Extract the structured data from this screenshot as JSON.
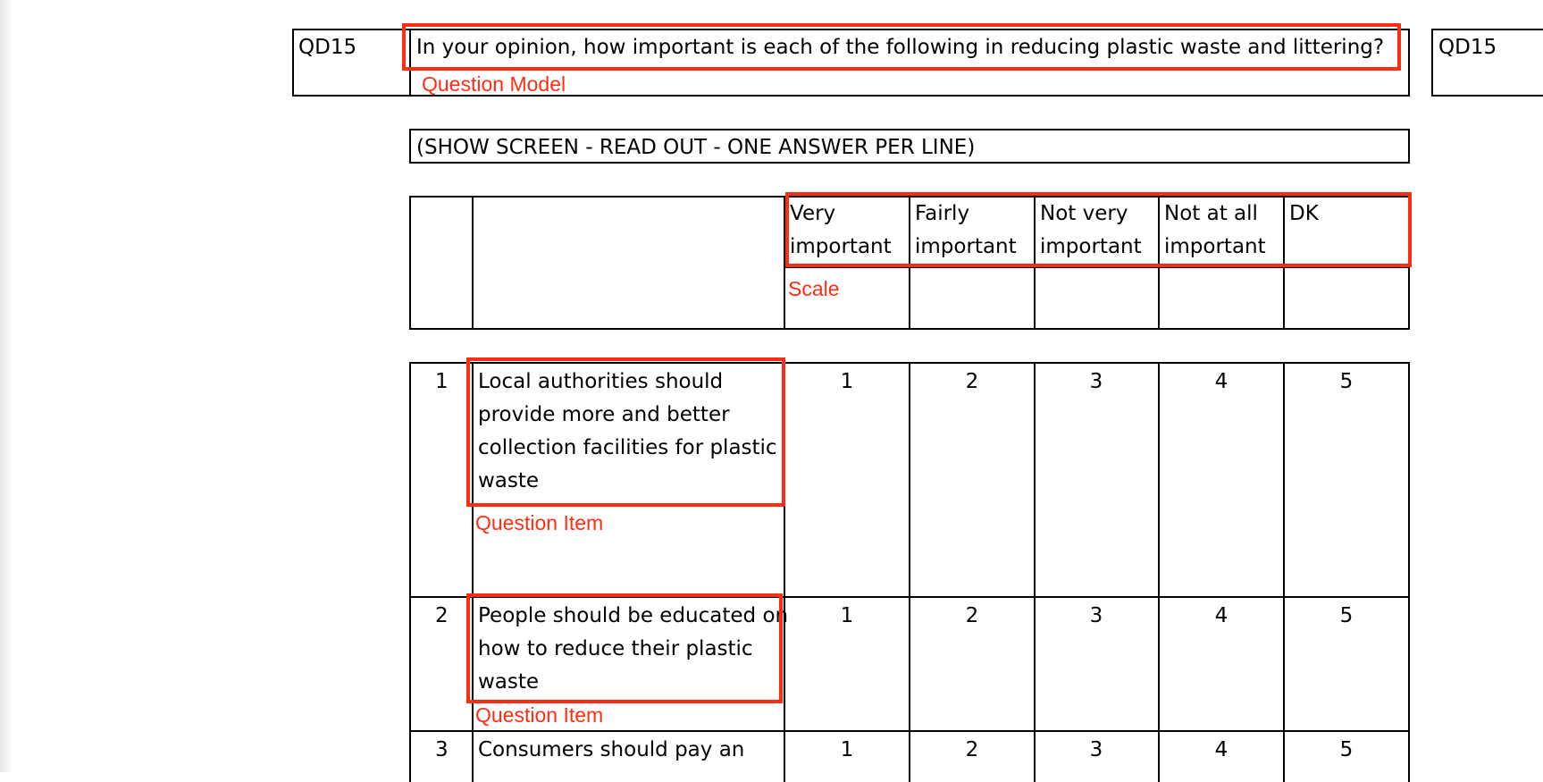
{
  "question": {
    "code": "QD15",
    "text": "In your opinion, how important is each of the following in reducing plastic waste and littering?",
    "instruction": "(SHOW SCREEN - READ OUT - ONE ANSWER PER LINE)",
    "next_code": "QD15"
  },
  "scale": {
    "headers": [
      [
        "Very",
        "important"
      ],
      [
        "Fairly",
        "important"
      ],
      [
        "Not very",
        "important"
      ],
      [
        "Not at all",
        "important"
      ],
      [
        "DK",
        ""
      ]
    ]
  },
  "items": [
    {
      "number": "1",
      "lines": [
        "Local authorities should",
        "provide more and better",
        "collection facilities for plastic",
        "waste"
      ],
      "codes": [
        "1",
        "2",
        "3",
        "4",
        "5"
      ]
    },
    {
      "number": "2",
      "lines": [
        "People should be educated on",
        "how to reduce their plastic",
        "waste"
      ],
      "codes": [
        "1",
        "2",
        "3",
        "4",
        "5"
      ]
    },
    {
      "number": "3",
      "lines": [
        "Consumers should pay an"
      ],
      "codes": [
        "1",
        "2",
        "3",
        "4",
        "5"
      ]
    }
  ],
  "annotations": {
    "question_model": "Question Model",
    "scale": "Scale",
    "question_item_1": "Question Item",
    "question_item_2": "Question Item",
    "color": "#ff2e12"
  }
}
